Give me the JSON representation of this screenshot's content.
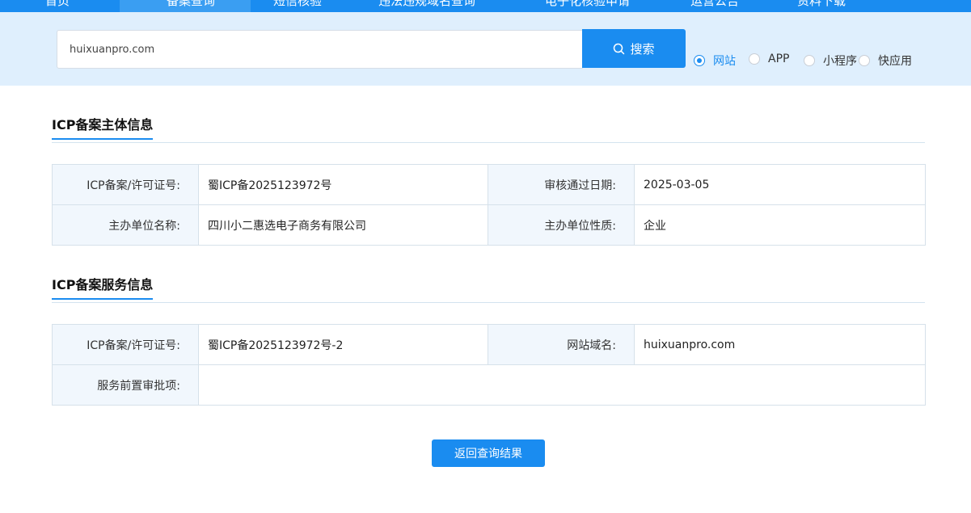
{
  "nav": {
    "items": [
      {
        "label": "首页"
      },
      {
        "label": "备案查询"
      },
      {
        "label": "短信核验"
      },
      {
        "label": "违法违规域名查询"
      },
      {
        "label": "电子化核验申请"
      },
      {
        "label": "运营公告"
      },
      {
        "label": "资料下载"
      }
    ],
    "active_index": 1
  },
  "search": {
    "value": "huixuanpro.com",
    "button_label": "搜索",
    "options": [
      {
        "label": "网站",
        "checked": true
      },
      {
        "label": "APP",
        "checked": false
      },
      {
        "label": "小程序",
        "checked": false
      },
      {
        "label": "快应用",
        "checked": false
      }
    ]
  },
  "subject": {
    "title": "ICP备案主体信息",
    "license_label": "ICP备案/许可证号:",
    "license_value": "蜀ICP备2025123972号",
    "approve_date_label": "审核通过日期:",
    "approve_date_value": "2025-03-05",
    "org_name_label": "主办单位名称:",
    "org_name_value": "四川小二惠选电子商务有限公司",
    "org_type_label": "主办单位性质:",
    "org_type_value": "企业"
  },
  "service": {
    "title": "ICP备案服务信息",
    "license_label": "ICP备案/许可证号:",
    "license_value": "蜀ICP备2025123972号-2",
    "domain_label": "网站域名:",
    "domain_value": "huixuanpro.com",
    "pre_approval_label": "服务前置审批项:",
    "pre_approval_value": ""
  },
  "back_button_label": "返回查询结果",
  "colors": {
    "accent": "#1a8cf0",
    "band": "#dfeffd",
    "label_bg": "#f1f7fd"
  }
}
